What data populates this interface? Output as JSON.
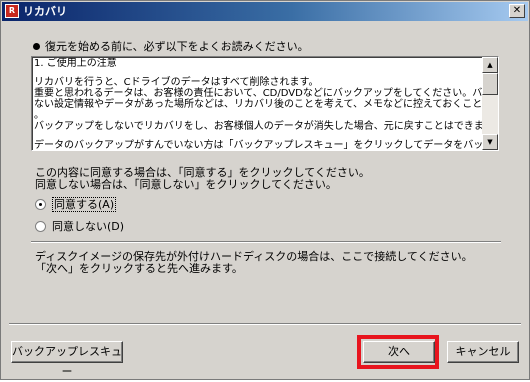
{
  "window": {
    "title": "リカバリ",
    "icon_glyph": "R",
    "close_glyph": "✕"
  },
  "heading": "復元を始める前に、必ず以下をよくお読みください。",
  "notice": {
    "lines": [
      "1. ご使用上の注意",
      "",
      "リカバリを行うと、Cドライブのデータはすべて削除されます。",
      "重要と思われるデータは、お客様の責任において、CD/DVDなどにバックアップをしてください。バックアップでき",
      "ない設定情報やデータがあった場所などは、リカバリ後のことを考えて、メモなどに控えておくことをお勧めします",
      "。",
      "バックアップをしないでリカバリをし、お客様個人のデータが消失した場合、元に戻すことはできません。",
      "",
      "データのバックアップがすんでいない方は「バックアップレスキュー」をクリックしてデータをバックアップしてくださ"
    ]
  },
  "agreement": {
    "line1": "この内容に同意する場合は、「同意する」をクリックしてください。",
    "line2": "同意しない場合は、「同意しない」をクリックしてください。",
    "options": [
      {
        "label": "同意する(A)",
        "checked": true
      },
      {
        "label": "同意しない(D)",
        "checked": false
      }
    ]
  },
  "info": {
    "line1": "ディスクイメージの保存先が外付けハードディスクの場合は、ここで接続してください。",
    "line2": "「次へ」をクリックすると先へ進みます。"
  },
  "buttons": {
    "backup_rescue": "バックアップレスキュー",
    "next": "次へ",
    "cancel": "キャンセル"
  },
  "colors": {
    "highlight": "#e8141e",
    "face": "#d6d3ce"
  }
}
